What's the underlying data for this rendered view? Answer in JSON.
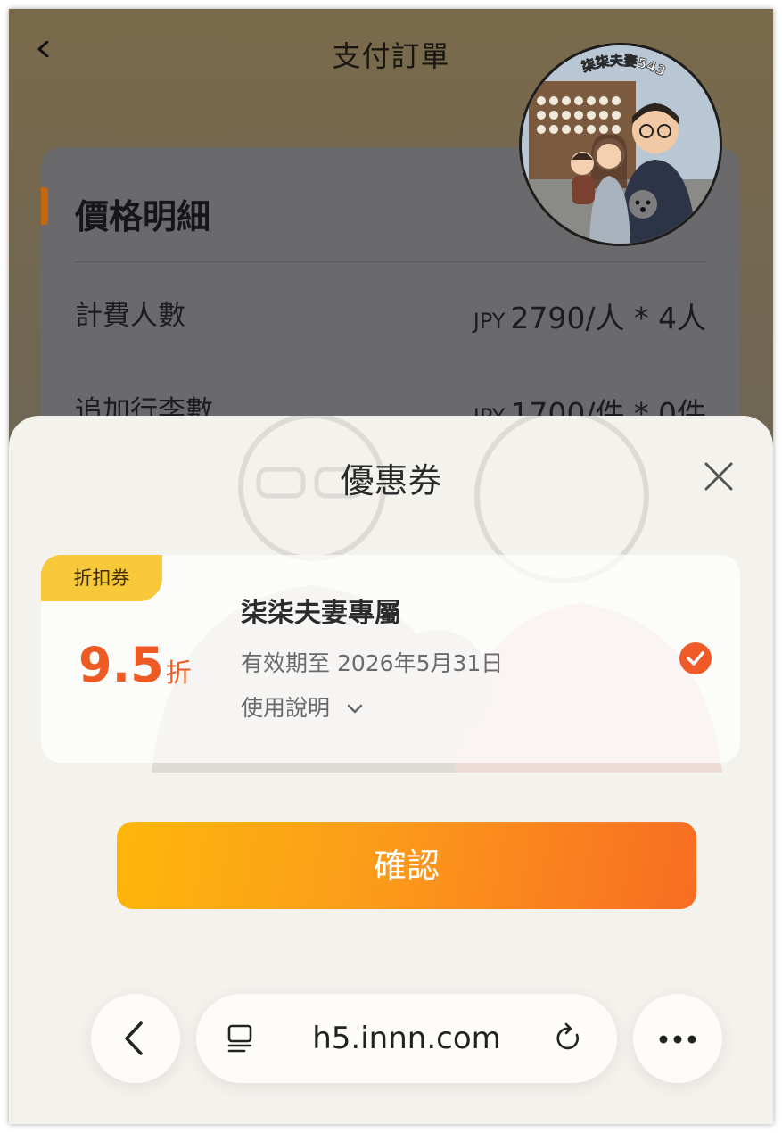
{
  "header": {
    "title": "支付訂單"
  },
  "price_details": {
    "heading": "價格明細",
    "rows": [
      {
        "label": "計費人數",
        "currency": "JPY",
        "value": "2790/人 * 4人"
      },
      {
        "label": "追加行李數",
        "currency": "JPY",
        "value": "1700/件 * 0件"
      }
    ]
  },
  "coupon_sheet": {
    "title": "優惠券",
    "coupon": {
      "tag": "折扣券",
      "discount_value": "9.5",
      "discount_unit": "折",
      "name": "柒柒夫妻專屬",
      "expiry": "有效期至 2026年5月31日",
      "usage_label": "使用說明",
      "selected": true
    },
    "confirm_label": "確認"
  },
  "browser_bar": {
    "url": "h5.innn.com"
  },
  "avatar_text": "柒柒夫妻543",
  "colors": {
    "accent": "#ee5a24",
    "tag": "#f7c83a",
    "button_start": "#fdb70c",
    "button_end": "#f86c22"
  },
  "icons": [
    "chevron-left-icon",
    "close-icon",
    "check-icon",
    "chevron-down-icon",
    "tabs-icon",
    "reload-icon",
    "more-icon"
  ]
}
